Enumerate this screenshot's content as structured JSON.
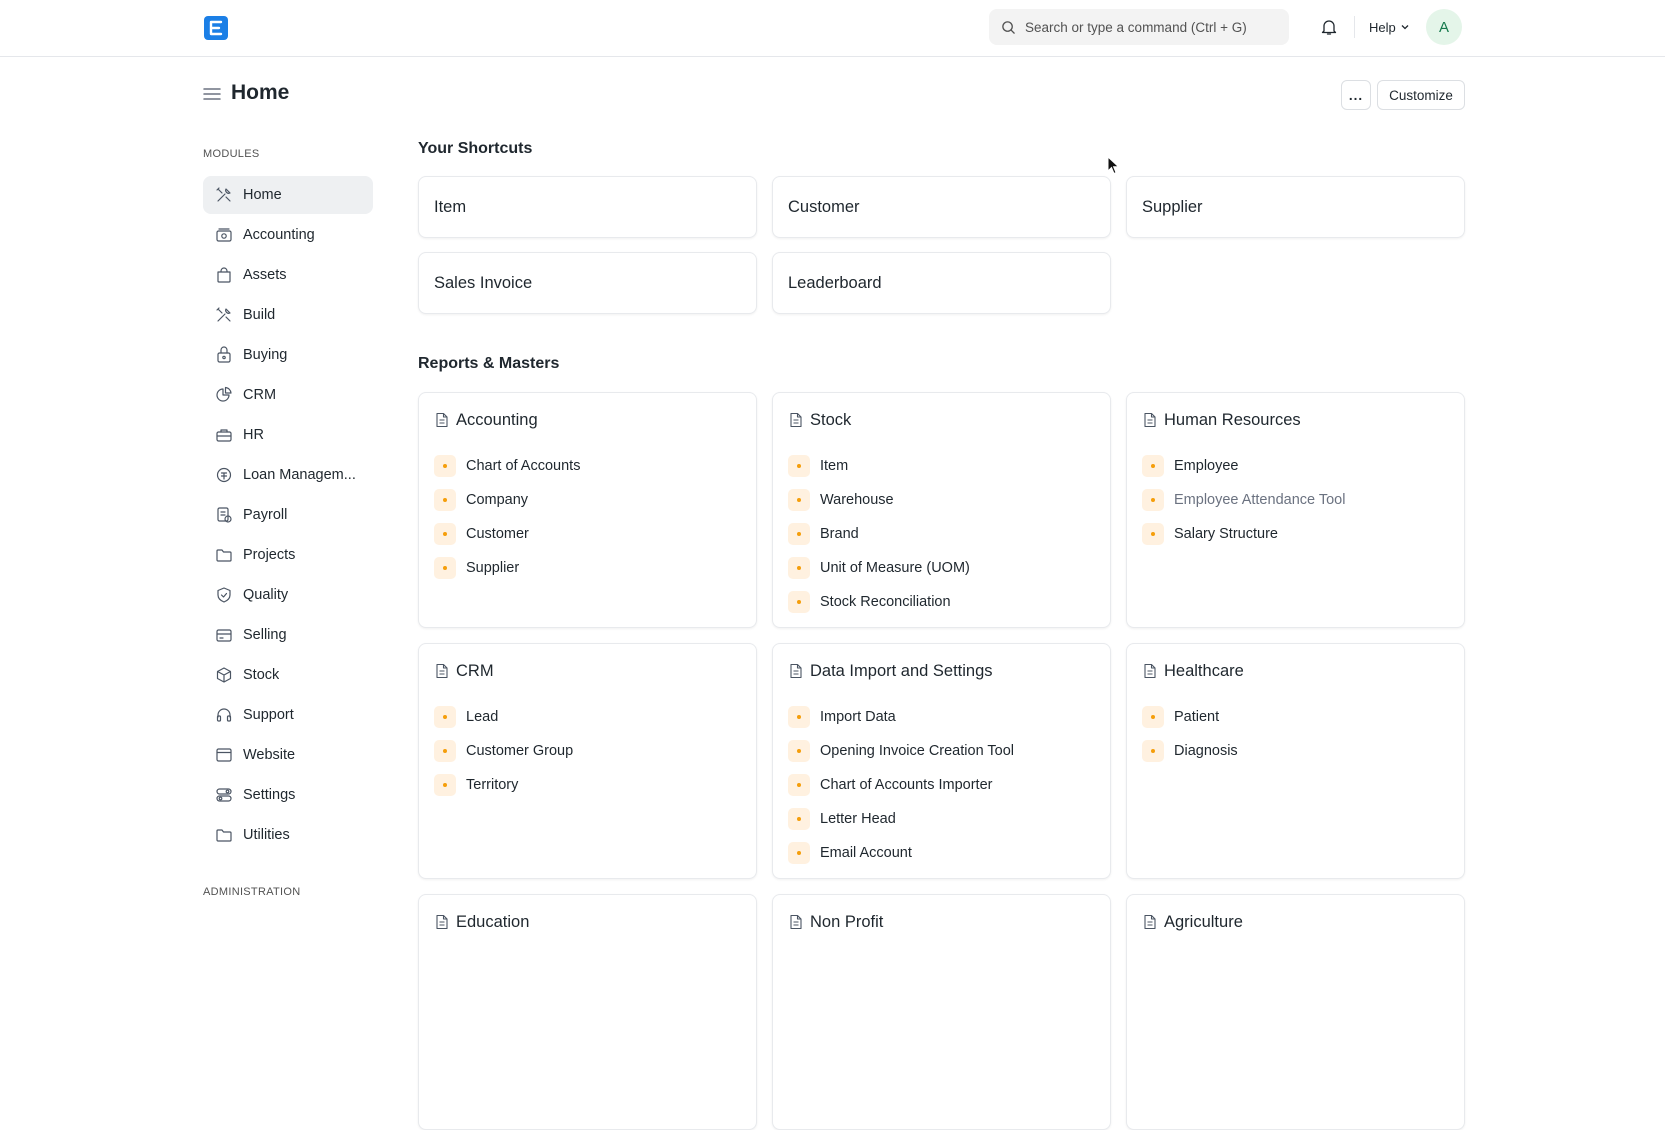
{
  "navbar": {
    "logo_letter": "E",
    "search_placeholder": "Search or type a command (Ctrl + G)",
    "help_label": "Help",
    "avatar_initial": "A"
  },
  "page": {
    "title": "Home",
    "more_label": "...",
    "customize_label": "Customize"
  },
  "sidebar": {
    "modules_heading": "MODULES",
    "admin_heading": "ADMINISTRATION",
    "items": [
      {
        "label": "Home",
        "icon": "tools-icon"
      },
      {
        "label": "Accounting",
        "icon": "money-icon"
      },
      {
        "label": "Assets",
        "icon": "bag-icon"
      },
      {
        "label": "Build",
        "icon": "tools-icon"
      },
      {
        "label": "Buying",
        "icon": "basket-icon"
      },
      {
        "label": "CRM",
        "icon": "pie-chart-icon"
      },
      {
        "label": "HR",
        "icon": "briefcase-icon"
      },
      {
        "label": "Loan Managem...",
        "icon": "loan-icon"
      },
      {
        "label": "Payroll",
        "icon": "payroll-icon"
      },
      {
        "label": "Projects",
        "icon": "folder-icon"
      },
      {
        "label": "Quality",
        "icon": "shield-icon"
      },
      {
        "label": "Selling",
        "icon": "card-icon"
      },
      {
        "label": "Stock",
        "icon": "box-icon"
      },
      {
        "label": "Support",
        "icon": "headset-icon"
      },
      {
        "label": "Website",
        "icon": "browser-icon"
      },
      {
        "label": "Settings",
        "icon": "toggle-icon"
      },
      {
        "label": "Utilities",
        "icon": "folder-icon"
      }
    ]
  },
  "shortcuts": {
    "heading": "Your Shortcuts",
    "items": [
      "Item",
      "Customer",
      "Supplier",
      "Sales Invoice",
      "Leaderboard"
    ]
  },
  "reports": {
    "heading": "Reports & Masters",
    "cards": [
      {
        "title": "Accounting",
        "links": [
          "Chart of Accounts",
          "Company",
          "Customer",
          "Supplier"
        ]
      },
      {
        "title": "Stock",
        "links": [
          "Item",
          "Warehouse",
          "Brand",
          "Unit of Measure (UOM)",
          "Stock Reconciliation"
        ]
      },
      {
        "title": "Human Resources",
        "links": [
          "Employee",
          "Employee Attendance Tool",
          "Salary Structure"
        ]
      },
      {
        "title": "CRM",
        "links": [
          "Lead",
          "Customer Group",
          "Territory"
        ]
      },
      {
        "title": "Data Import and Settings",
        "links": [
          "Import Data",
          "Opening Invoice Creation Tool",
          "Chart of Accounts Importer",
          "Letter Head",
          "Email Account"
        ]
      },
      {
        "title": "Healthcare",
        "links": [
          "Patient",
          "Diagnosis"
        ]
      },
      {
        "title": "Education",
        "links": []
      },
      {
        "title": "Non Profit",
        "links": []
      },
      {
        "title": "Agriculture",
        "links": []
      }
    ]
  },
  "colors": {
    "brand": "#1b7fe6",
    "dot": "#f59e0b",
    "dot_bg": "#fff1e0",
    "active_bg": "#eef0f2"
  }
}
